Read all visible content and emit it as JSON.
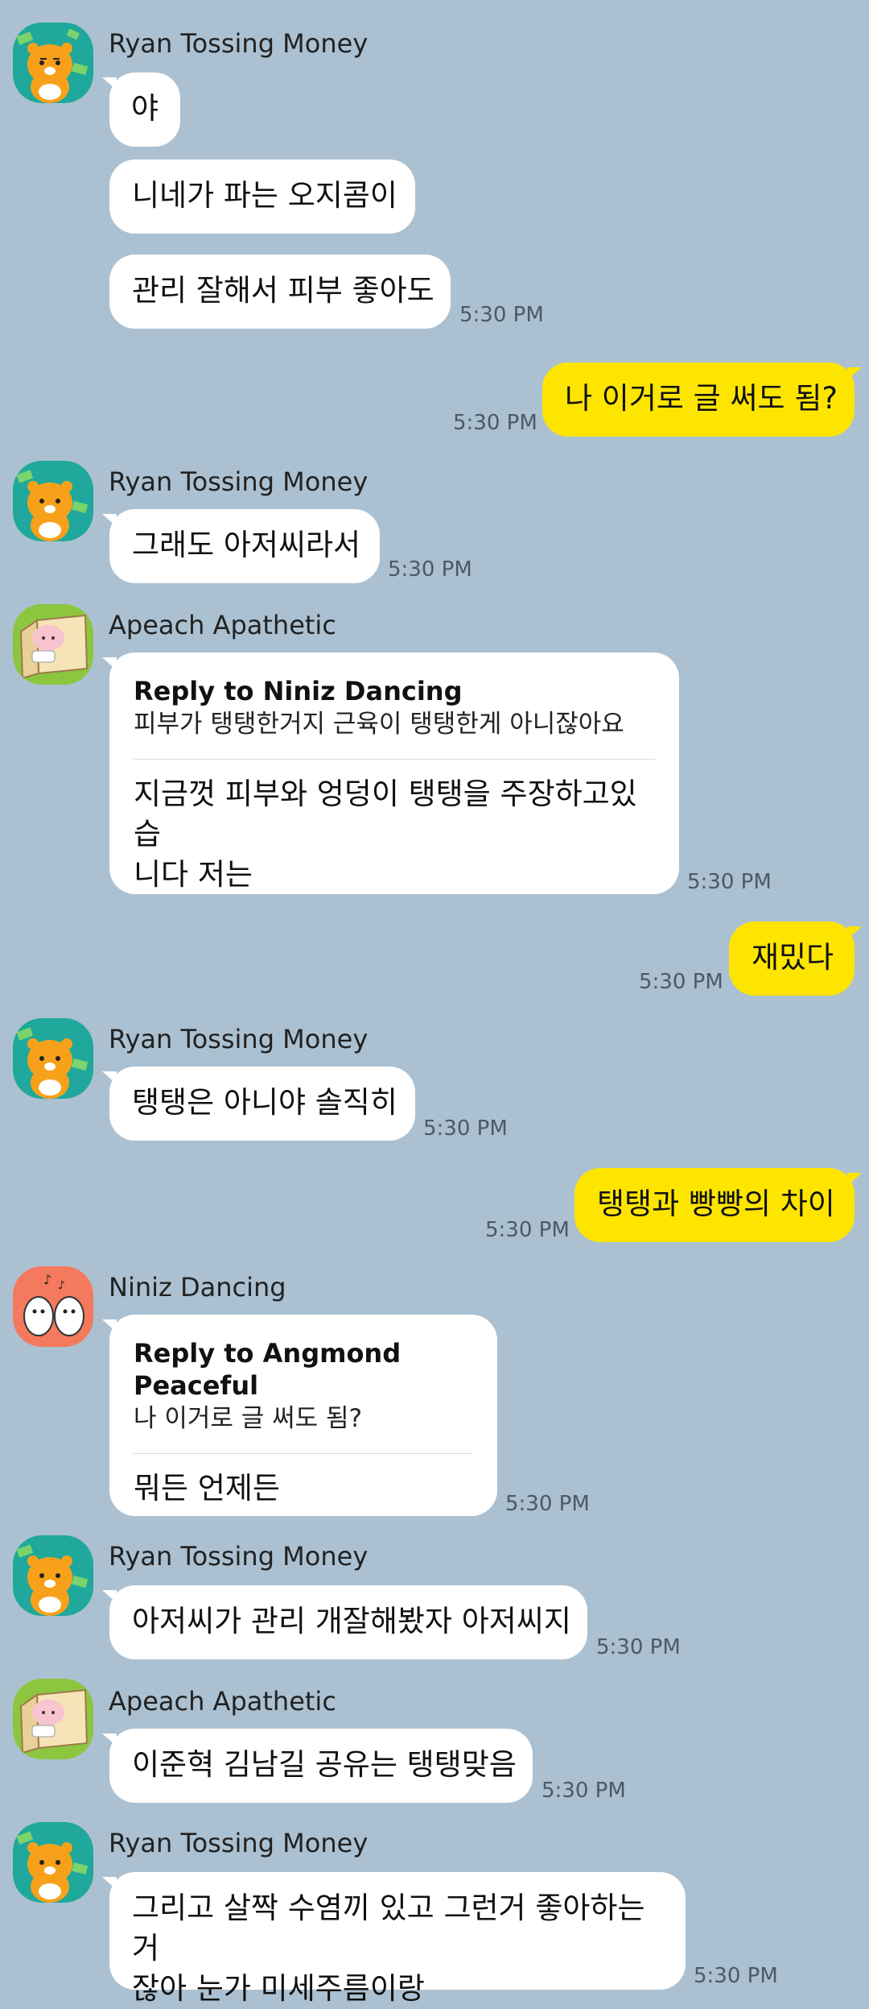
{
  "messages": [
    {
      "sender": "Ryan Tossing Money",
      "avatar": "ryan-avatar",
      "bubbles": [
        "야",
        "니네가 파는 오지콤이",
        "관리 잘해서 피부 좋아도"
      ],
      "time": "5:30 PM"
    },
    {
      "sender": "me",
      "text": "나 이거로 글 써도 됨?",
      "time": "5:30 PM"
    },
    {
      "sender": "Ryan Tossing Money",
      "avatar": "ryan-avatar",
      "bubbles": [
        "그래도 아저씨라서"
      ],
      "time": "5:30 PM"
    },
    {
      "sender": "Apeach Apathetic",
      "avatar": "apeach-avatar",
      "reply_to": "Reply to Niniz Dancing",
      "reply_text": "피부가 탱탱한거지 근육이 탱탱한게 아니잖아요",
      "text_lines": [
        "지금껏 피부와 엉덩이 탱탱을 주장하고있습",
        "니다 저는"
      ],
      "time": "5:30 PM"
    },
    {
      "sender": "me",
      "text": "재밌다",
      "time": "5:30 PM"
    },
    {
      "sender": "Ryan Tossing Money",
      "avatar": "ryan-avatar",
      "bubbles": [
        "탱탱은 아니야 솔직히"
      ],
      "time": "5:30 PM"
    },
    {
      "sender": "me",
      "text": "탱탱과 빵빵의 차이",
      "time": "5:30 PM"
    },
    {
      "sender": "Niniz Dancing",
      "avatar": "niniz-avatar",
      "reply_to": "Reply to Angmond Peaceful",
      "reply_text": "나 이거로 글 써도 됨?",
      "text_lines": [
        "뭐든 언제든"
      ],
      "time": "5:30 PM"
    },
    {
      "sender": "Ryan Tossing Money",
      "avatar": "ryan-avatar",
      "bubbles": [
        "아저씨가 관리 개잘해봤자 아저씨지"
      ],
      "time": "5:30 PM"
    },
    {
      "sender": "Apeach Apathetic",
      "avatar": "apeach-avatar",
      "bubbles": [
        "이준혁 김남길 공유는 탱탱맞음"
      ],
      "time": "5:30 PM"
    },
    {
      "sender": "Ryan Tossing Money",
      "avatar": "ryan-avatar",
      "text_lines": [
        "그리고 살짝 수염끼 있고 그런거 좋아하는거",
        "잖아 눈가 미세주름이랑"
      ],
      "time": "5:30 PM"
    }
  ],
  "colors": {
    "background": "#abc1d1",
    "my_bubble": "#fee500",
    "other_bubble": "#ffffff",
    "ryan_avatar_bg": "#1fa89b",
    "apeach_avatar_bg": "#8cc63f",
    "niniz_avatar_bg": "#f4795d"
  }
}
